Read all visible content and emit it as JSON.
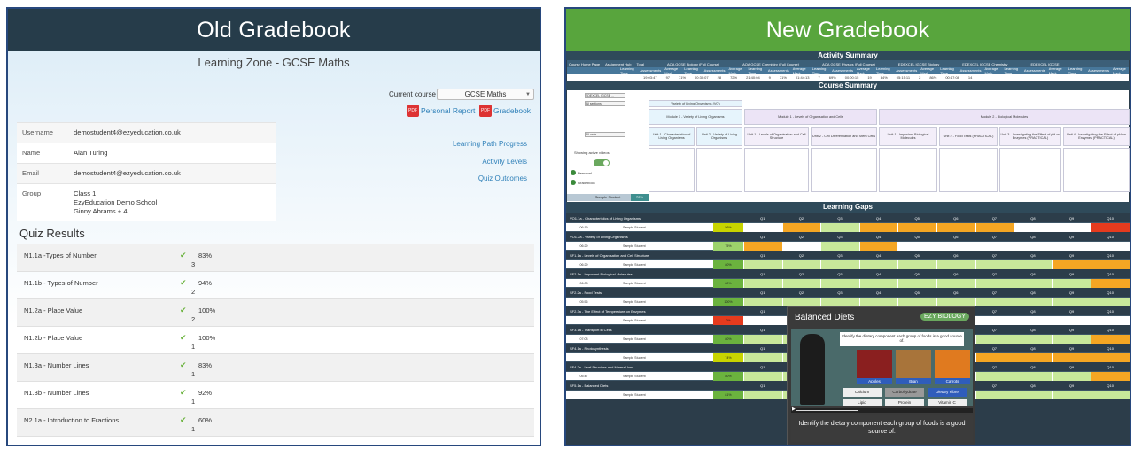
{
  "old_gradebook": {
    "banner": "Old Gradebook",
    "page_title": "Learning Zone - GCSE Maths",
    "current_course_label": "Current course",
    "course_select": "GCSE Maths",
    "personal_report": "Personal Report",
    "gradebook": "Gradebook",
    "side_links": [
      "Learning Path Progress",
      "Activity Levels",
      "Quiz Outcomes"
    ],
    "profile": [
      {
        "label": "Username",
        "value": "demostudent4@ezyeducation.co.uk"
      },
      {
        "label": "Name",
        "value": "Alan Turing"
      },
      {
        "label": "Email",
        "value": "demostudent4@ezyeducation.co.uk"
      },
      {
        "label": "Group",
        "value": "Class 1\nEzyEducation Demo School\nGinny Abrams + 4"
      }
    ],
    "quiz_title": "Quiz Results",
    "quiz_results": [
      {
        "name": "N1.1a -Types of Number",
        "pct": "83%",
        "count": "3"
      },
      {
        "name": "N1.1b - Types of Number",
        "pct": "94%",
        "count": "2"
      },
      {
        "name": "N1.2a - Place Value",
        "pct": "100%",
        "count": "2"
      },
      {
        "name": "N1.2b - Place Value",
        "pct": "100%",
        "count": "1"
      },
      {
        "name": "N1.3a - Number Lines",
        "pct": "83%",
        "count": "1"
      },
      {
        "name": "N1.3b - Number Lines",
        "pct": "92%",
        "count": "1"
      },
      {
        "name": "N2.1a - Introduction to Fractions",
        "pct": "60%",
        "count": "1"
      }
    ]
  },
  "new_gradebook": {
    "banner": "New Gradebook",
    "activity_summary": "Activity Summary",
    "activity_header": [
      "Course Home Page",
      "Assignment Hub",
      "Total",
      "AQA GCSE Biology (Full Course)",
      "AQA GCSE Chemistry (Full Course)",
      "AQA GCSE Physics (Full Course)",
      "EDEXCEL IGCSE Biology",
      "EDEXCEL IGCSE Chemistry",
      "EDEXCEL IGCSE"
    ],
    "activity_sub": [
      "Learning Time",
      "Assessments",
      "Average Mark",
      "Learning Time",
      "Assessments",
      "Average Mark"
    ],
    "activity_values": [
      "19:03:47",
      "97",
      "71%",
      "00:30:07",
      "28",
      "72%",
      "21:40:04",
      "9",
      "71%",
      "01:44:13",
      "7",
      "69%",
      "00:00:15",
      "19",
      "84%",
      "05:15:11",
      "2",
      "86%",
      "00:47:08",
      "14"
    ],
    "course_summary": "Course Summary",
    "course_select": "EDEXCEL IGCSE ...",
    "sections_select": "All sections",
    "units_select": "All units",
    "sub_heading": "Variety of Living Organisms (VO)",
    "module1": "Module 1 - Variety of Living Organisms",
    "module_lo": "Module 1 - Levels of Organisation and Cells",
    "module2": "Module 2 - Biological Molecules",
    "units": [
      "Unit 1 - Characteristics of Living Organisms",
      "Unit 2 - Variety of Living Organisms",
      "Unit 1 - Levels of Organisation and Cell Structure",
      "Unit 2 - Cell Differentiation and Stem Cells",
      "Unit 1 - Important Biological Molecules",
      "Unit 2 - Food Tests (PRACTICAL)",
      "Unit 3 - Investigating the Effect of pH on Enzymes (PRACTICAL)",
      "Unit 4 - Investigating the Effect of pH on Enzymes (PRACTICAL)"
    ],
    "showing_label": "Showing active videos",
    "personal": "Personal",
    "gradebook": "Gradebook",
    "sample_student": "Sample Student",
    "sample_pct": "70%",
    "learning_gaps": "Learning Gaps",
    "q_labels": [
      "Q1",
      "Q2",
      "Q3",
      "Q4",
      "Q5",
      "Q6",
      "Q7",
      "Q8",
      "Q9",
      "Q10"
    ],
    "gaps": [
      {
        "title": "VO1.1a - Characteristics of Living Organisms",
        "date": "06:19",
        "pct": "56%",
        "pct_color": "#c8d400",
        "cells": [
          "#ffffff",
          "#f5a623",
          "#c8e89a",
          "#f5a623",
          "#f5a623",
          "#f5a623",
          "#f5a623",
          "#ffffff",
          "#ffffff",
          "#e53b1e"
        ]
      },
      {
        "title": "VO1.2a - Variety of Living Organisms",
        "date": "06:29",
        "pct": "75%",
        "pct_color": "#9cd36b",
        "cells": [
          "#f5a623",
          "#ffffff",
          "#c8e89a",
          "#f5a623",
          "#ffffff",
          "#ffffff",
          "#ffffff",
          "#ffffff",
          "#ffffff",
          "#ffffff"
        ]
      },
      {
        "title": "SF1.1a - Levels of Organisation and Cell Structure",
        "date": "06:29",
        "pct": "80%",
        "pct_color": "#6bb33e",
        "cells": [
          "#c8e89a",
          "#c8e89a",
          "#c8e89a",
          "#c8e89a",
          "#c8e89a",
          "#c8e89a",
          "#c8e89a",
          "#c8e89a",
          "#f5a623",
          "#f5a623"
        ]
      },
      {
        "title": "SF2.1a - Important Biological Molecules",
        "date": "06:08",
        "pct": "80%",
        "pct_color": "#6bb33e",
        "cells": [
          "#c8e89a",
          "#c8e89a",
          "#c8e89a",
          "#c8e89a",
          "#c8e89a",
          "#c8e89a",
          "#c8e89a",
          "#c8e89a",
          "#c8e89a",
          "#f5a623"
        ]
      },
      {
        "title": "SF2.2a - Food Tests",
        "date": "05:56",
        "pct": "100%",
        "pct_color": "#6bb33e",
        "cells": [
          "#c8e89a",
          "#c8e89a",
          "#c8e89a",
          "#c8e89a",
          "#c8e89a",
          "#c8e89a",
          "#c8e89a",
          "#c8e89a",
          "#c8e89a",
          "#c8e89a"
        ]
      },
      {
        "title": "SF2.3a - The Effect of Temperature on Enzymes",
        "date": "",
        "pct": "0%",
        "pct_color": "#e53b1e",
        "cells": [
          "#ffffff",
          "#ffffff",
          "#ffffff",
          "#ffffff",
          "#ffffff",
          "#ffffff",
          "#ffffff",
          "#ffffff",
          "#ffffff",
          "#ffffff"
        ]
      },
      {
        "title": "SF3.1a - Transport in Cells",
        "date": "07:08",
        "pct": "80%",
        "pct_color": "#6bb33e",
        "cells": [
          "#c8e89a",
          "#c8e89a",
          "#c8e89a",
          "#c8e89a",
          "#c8e89a",
          "#c8e89a",
          "#c8e89a",
          "#c8e89a",
          "#c8e89a",
          "#f5a623"
        ]
      },
      {
        "title": "SF4.1a - Photosynthesis",
        "date": "",
        "pct": "74%",
        "pct_color": "#c8d400",
        "cells": [
          "#c8e89a",
          "#c8e89a",
          "#c8e89a",
          "#c8e89a",
          "#c8e89a",
          "#c8e89a",
          "#f5a623",
          "#f5a623",
          "#f5a623",
          "#f5a623"
        ]
      },
      {
        "title": "SF4.2a - Leaf Structure and Mineral Ions",
        "date": "05:47",
        "pct": "80%",
        "pct_color": "#6bb33e",
        "cells": [
          "#c8e89a",
          "#c8e89a",
          "#c8e89a",
          "#c8e89a",
          "#c8e89a",
          "#c8e89a",
          "#c8e89a",
          "#c8e89a",
          "#c8e89a",
          "#f5a623"
        ]
      },
      {
        "title": "SF5.1a - Balanced Diets",
        "date": "",
        "pct": "81%",
        "pct_color": "#6bb33e",
        "cells": [
          "#c8e89a",
          "#c8e89a",
          "#c8e89a",
          "#c8e89a",
          "#c8e89a",
          "#c8e89a",
          "#c8e89a",
          "#c8e89a",
          "#c8e89a",
          "#c8e89a"
        ]
      }
    ],
    "video": {
      "title": "Balanced Diets",
      "brand": "EZY BIOLOGY",
      "question": "Identify the dietary component each group of foods is a good source of.",
      "foods": [
        "Apples",
        "Bran",
        "Carrots"
      ],
      "options": [
        "Calcium",
        "Carbohydrate",
        "Dietary Fibre",
        "Lipid",
        "Protein",
        "Vitamin C"
      ],
      "caption": "Identify the dietary component each group of foods is a good source of."
    }
  }
}
